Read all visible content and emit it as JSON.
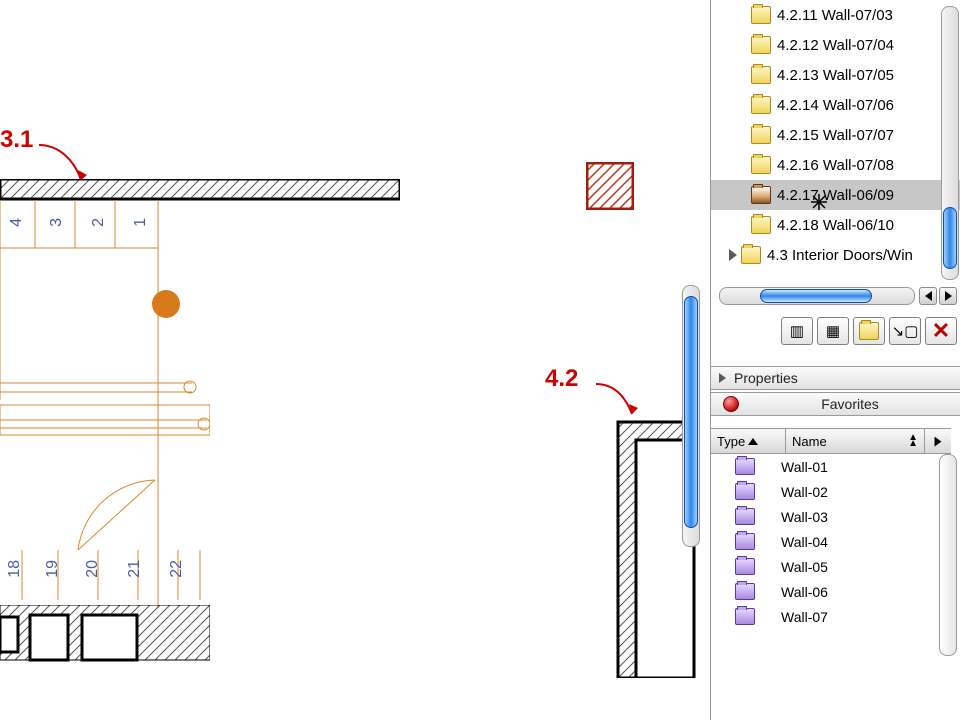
{
  "annotations": {
    "a1": "3.1",
    "a2": "4.2"
  },
  "stair_upper": [
    "4",
    "3",
    "2",
    "1"
  ],
  "stair_lower": [
    "18",
    "19",
    "20",
    "21",
    "22"
  ],
  "tree": {
    "items": [
      {
        "label": "4.2.11 Wall-07/03"
      },
      {
        "label": "4.2.12 Wall-07/04"
      },
      {
        "label": "4.2.13 Wall-07/05"
      },
      {
        "label": "4.2.14 Wall-07/06"
      },
      {
        "label": "4.2.15 Wall-07/07"
      },
      {
        "label": "4.2.16 Wall-07/08"
      },
      {
        "label": "4.2.17 Wall-06/09"
      },
      {
        "label": "4.2.18 Wall-06/10"
      }
    ],
    "parent": {
      "label": "4.3 Interior Doors/Win"
    }
  },
  "sections": {
    "properties": "Properties",
    "favorites": "Favorites"
  },
  "fav_headers": {
    "type": "Type",
    "name": "Name"
  },
  "favorites": [
    {
      "name": "Wall-01"
    },
    {
      "name": "Wall-02"
    },
    {
      "name": "Wall-03"
    },
    {
      "name": "Wall-04"
    },
    {
      "name": "Wall-05"
    },
    {
      "name": "Wall-06"
    },
    {
      "name": "Wall-07"
    }
  ]
}
